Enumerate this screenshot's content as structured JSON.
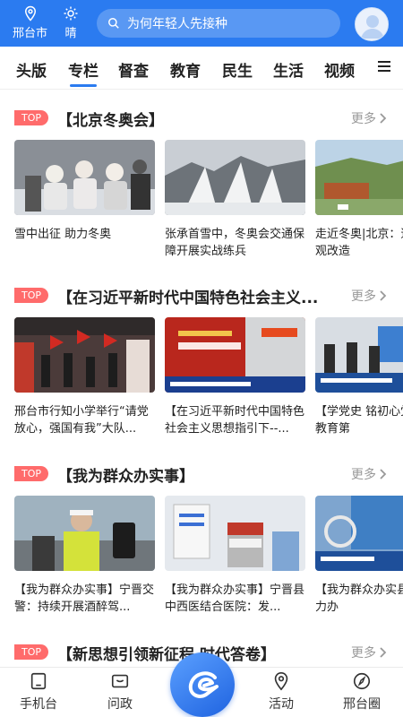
{
  "header": {
    "location": "邢台市",
    "weather": "晴",
    "search_placeholder": "为何年轻人先接种"
  },
  "tabs": [
    {
      "label": "头版",
      "active": false
    },
    {
      "label": "专栏",
      "active": true
    },
    {
      "label": "督查",
      "active": false
    },
    {
      "label": "教育",
      "active": false
    },
    {
      "label": "民生",
      "active": false
    },
    {
      "label": "生活",
      "active": false
    },
    {
      "label": "视频",
      "active": false
    }
  ],
  "sections": [
    {
      "badge": "TOP",
      "title": "【北京冬奥会】",
      "more": "更多",
      "cards": [
        {
          "caption": "雪中出征 助力冬奥"
        },
        {
          "caption": "张承首雪中，冬奥会交通保障开展实战练兵"
        },
        {
          "caption": "走近冬奥|北京：道”绿化景观改造"
        }
      ]
    },
    {
      "badge": "TOP",
      "title": "【在习近平新时代中国特色社会主义...",
      "more": "更多",
      "cards": [
        {
          "caption": "邢台市行知小学举行“请党放心，强国有我”大队..."
        },
        {
          "caption": "【在习近平新时代中国特色社会主义思想指引下--..."
        },
        {
          "caption": "【学党史 铭初心党史学习教育第"
        }
      ]
    },
    {
      "badge": "TOP",
      "title": "【我为群众办实事】",
      "more": "更多",
      "cards": [
        {
          "caption": "【我为群众办实事】宁晋交警：持续开展酒醉驾..."
        },
        {
          "caption": "【我为群众办实事】宁晋县中西医结合医院：发..."
        },
        {
          "caption": "【我为群众办实县：凝心聚力办"
        }
      ]
    },
    {
      "badge": "TOP",
      "title": "【新思想引领新征程 时代答卷】",
      "more": "更多",
      "cards": []
    }
  ],
  "bottom_nav": [
    {
      "label": "手机台",
      "icon": "phone-icon"
    },
    {
      "label": "问政",
      "icon": "message-icon"
    },
    {
      "label": "活动",
      "icon": "location-icon"
    },
    {
      "label": "邢台圈",
      "icon": "compass-icon"
    }
  ],
  "colors": {
    "brand": "#2b7bf0",
    "badge": "#ff6b6b"
  }
}
